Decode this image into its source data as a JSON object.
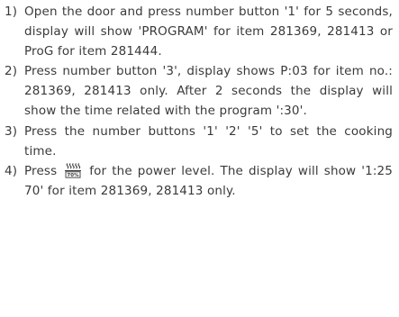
{
  "steps": [
    {
      "number": "1)",
      "text": "Open the door and press number button '1' for 5 seconds, display will show 'PROGRAM' for item 281369, 281413 or ProG for item 281444."
    },
    {
      "number": "2)",
      "text": "Press number button '3', display shows P:03 for item no.: 281369, 281413 only. After 2 seconds the display will show the time related with the program ':30'."
    },
    {
      "number": "3)",
      "text": "Press the number buttons '1' '2' '5' to set the cooking time."
    },
    {
      "number": "4)",
      "text_before_icon": "Press",
      "icon": "power-level-icon",
      "icon_label": "70%",
      "text_after_icon": "for the power level. The display will show '1:25  70' for item 281369, 281413 only."
    }
  ]
}
